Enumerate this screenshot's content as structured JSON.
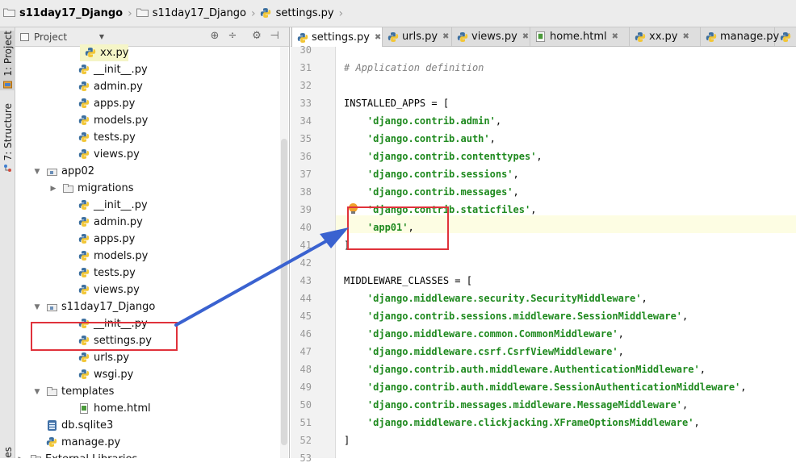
{
  "breadcrumb": [
    {
      "label": "s11day17_Django",
      "icon": "folder-icon",
      "bold": true
    },
    {
      "label": "s11day17_Django",
      "icon": "folder-icon",
      "bold": false
    },
    {
      "label": "settings.py",
      "icon": "python-file-icon",
      "bold": false
    }
  ],
  "stripe": {
    "project_tab": "1: Project",
    "structure_tab": "7: Structure",
    "favorites_tab": "es"
  },
  "project_panel": {
    "view_label": "Project",
    "toolbar_icons": [
      "target-icon",
      "collapse-icon",
      "gear-icon",
      "hide-icon"
    ]
  },
  "tree": [
    {
      "label": "xx.py",
      "type": "py",
      "depth": 4,
      "expander": "",
      "highlight": true
    },
    {
      "label": "__init__.py",
      "type": "py",
      "depth": 3,
      "expander": ""
    },
    {
      "label": "admin.py",
      "type": "py",
      "depth": 3,
      "expander": ""
    },
    {
      "label": "apps.py",
      "type": "py",
      "depth": 3,
      "expander": ""
    },
    {
      "label": "models.py",
      "type": "py",
      "depth": 3,
      "expander": ""
    },
    {
      "label": "tests.py",
      "type": "py",
      "depth": 3,
      "expander": ""
    },
    {
      "label": "views.py",
      "type": "py",
      "depth": 3,
      "expander": ""
    },
    {
      "label": "app02",
      "type": "pkg",
      "depth": 1,
      "expander": "open"
    },
    {
      "label": "migrations",
      "type": "folder",
      "depth": 2,
      "expander": "closed"
    },
    {
      "label": "__init__.py",
      "type": "py",
      "depth": 3,
      "expander": ""
    },
    {
      "label": "admin.py",
      "type": "py",
      "depth": 3,
      "expander": ""
    },
    {
      "label": "apps.py",
      "type": "py",
      "depth": 3,
      "expander": ""
    },
    {
      "label": "models.py",
      "type": "py",
      "depth": 3,
      "expander": ""
    },
    {
      "label": "tests.py",
      "type": "py",
      "depth": 3,
      "expander": ""
    },
    {
      "label": "views.py",
      "type": "py",
      "depth": 3,
      "expander": ""
    },
    {
      "label": "s11day17_Django",
      "type": "pkg",
      "depth": 1,
      "expander": "open"
    },
    {
      "label": "__init__.py",
      "type": "py",
      "depth": 3,
      "expander": ""
    },
    {
      "label": "settings.py",
      "type": "py",
      "depth": 3,
      "expander": ""
    },
    {
      "label": "urls.py",
      "type": "py",
      "depth": 3,
      "expander": ""
    },
    {
      "label": "wsgi.py",
      "type": "py",
      "depth": 3,
      "expander": ""
    },
    {
      "label": "templates",
      "type": "folder",
      "depth": 1,
      "expander": "open"
    },
    {
      "label": "home.html",
      "type": "html",
      "depth": 3,
      "expander": ""
    },
    {
      "label": "db.sqlite3",
      "type": "db",
      "depth": 1,
      "expander": ""
    },
    {
      "label": "manage.py",
      "type": "py",
      "depth": 1,
      "expander": ""
    },
    {
      "label": "External Libraries",
      "type": "folder",
      "depth": 0,
      "expander": "closed"
    }
  ],
  "tabs": [
    {
      "label": "settings.py",
      "icon": "python-file-icon",
      "active": true
    },
    {
      "label": "urls.py",
      "icon": "python-file-icon",
      "active": false
    },
    {
      "label": "views.py",
      "icon": "python-file-icon",
      "active": false
    },
    {
      "label": "home.html",
      "icon": "html-file-icon",
      "active": false
    },
    {
      "label": "xx.py",
      "icon": "python-file-icon",
      "active": false
    },
    {
      "label": "manage.py",
      "icon": "python-file-icon",
      "active": false
    },
    {
      "label": "",
      "icon": "python-file-icon",
      "active": false
    }
  ],
  "code": [
    {
      "n": "30",
      "parts": []
    },
    {
      "n": "31",
      "parts": [
        {
          "t": "# Application definition",
          "c": "comment"
        }
      ]
    },
    {
      "n": "32",
      "parts": []
    },
    {
      "n": "33",
      "parts": [
        {
          "t": "INSTALLED_APPS = [",
          "c": ""
        }
      ]
    },
    {
      "n": "34",
      "parts": [
        {
          "t": "    ",
          "c": ""
        },
        {
          "t": "'django.contrib.admin'",
          "c": "str"
        },
        {
          "t": ",",
          "c": ""
        }
      ]
    },
    {
      "n": "35",
      "parts": [
        {
          "t": "    ",
          "c": ""
        },
        {
          "t": "'django.contrib.auth'",
          "c": "str"
        },
        {
          "t": ",",
          "c": ""
        }
      ]
    },
    {
      "n": "36",
      "parts": [
        {
          "t": "    ",
          "c": ""
        },
        {
          "t": "'django.contrib.contenttypes'",
          "c": "str"
        },
        {
          "t": ",",
          "c": ""
        }
      ]
    },
    {
      "n": "37",
      "parts": [
        {
          "t": "    ",
          "c": ""
        },
        {
          "t": "'django.contrib.sessions'",
          "c": "str"
        },
        {
          "t": ",",
          "c": ""
        }
      ]
    },
    {
      "n": "38",
      "parts": [
        {
          "t": "    ",
          "c": ""
        },
        {
          "t": "'django.contrib.messages'",
          "c": "str"
        },
        {
          "t": ",",
          "c": ""
        }
      ]
    },
    {
      "n": "39",
      "parts": [
        {
          "t": "    ",
          "c": ""
        },
        {
          "t": "'django.contrib.staticfiles'",
          "c": "str"
        },
        {
          "t": ",",
          "c": ""
        }
      ]
    },
    {
      "n": "40",
      "parts": [
        {
          "t": "    ",
          "c": ""
        },
        {
          "t": "'app01'",
          "c": "str"
        },
        {
          "t": ",",
          "c": ""
        }
      ]
    },
    {
      "n": "41",
      "parts": [
        {
          "t": "]",
          "c": ""
        }
      ]
    },
    {
      "n": "42",
      "parts": []
    },
    {
      "n": "43",
      "parts": [
        {
          "t": "MIDDLEWARE_CLASSES = [",
          "c": ""
        }
      ]
    },
    {
      "n": "44",
      "parts": [
        {
          "t": "    ",
          "c": ""
        },
        {
          "t": "'django.middleware.security.SecurityMiddleware'",
          "c": "str"
        },
        {
          "t": ",",
          "c": ""
        }
      ]
    },
    {
      "n": "45",
      "parts": [
        {
          "t": "    ",
          "c": ""
        },
        {
          "t": "'django.contrib.sessions.middleware.SessionMiddleware'",
          "c": "str"
        },
        {
          "t": ",",
          "c": ""
        }
      ]
    },
    {
      "n": "46",
      "parts": [
        {
          "t": "    ",
          "c": ""
        },
        {
          "t": "'django.middleware.common.CommonMiddleware'",
          "c": "str"
        },
        {
          "t": ",",
          "c": ""
        }
      ]
    },
    {
      "n": "47",
      "parts": [
        {
          "t": "    ",
          "c": ""
        },
        {
          "t": "'django.middleware.csrf.CsrfViewMiddleware'",
          "c": "str"
        },
        {
          "t": ",",
          "c": ""
        }
      ]
    },
    {
      "n": "48",
      "parts": [
        {
          "t": "    ",
          "c": ""
        },
        {
          "t": "'django.contrib.auth.middleware.AuthenticationMiddleware'",
          "c": "str"
        },
        {
          "t": ",",
          "c": ""
        }
      ]
    },
    {
      "n": "49",
      "parts": [
        {
          "t": "    ",
          "c": ""
        },
        {
          "t": "'django.contrib.auth.middleware.SessionAuthenticationMiddleware'",
          "c": "str"
        },
        {
          "t": ",",
          "c": ""
        }
      ]
    },
    {
      "n": "50",
      "parts": [
        {
          "t": "    ",
          "c": ""
        },
        {
          "t": "'django.contrib.messages.middleware.MessageMiddleware'",
          "c": "str"
        },
        {
          "t": ",",
          "c": ""
        }
      ]
    },
    {
      "n": "51",
      "parts": [
        {
          "t": "    ",
          "c": ""
        },
        {
          "t": "'django.middleware.clickjacking.XFrameOptionsMiddleware'",
          "c": "str"
        },
        {
          "t": ",",
          "c": ""
        }
      ]
    },
    {
      "n": "52",
      "parts": [
        {
          "t": "]",
          "c": ""
        }
      ]
    },
    {
      "n": "53",
      "parts": []
    }
  ],
  "colors": {
    "annotation_red": "#e0323b",
    "annotation_arrow": "#3a62d0",
    "string_green": "#1f8a1f"
  }
}
